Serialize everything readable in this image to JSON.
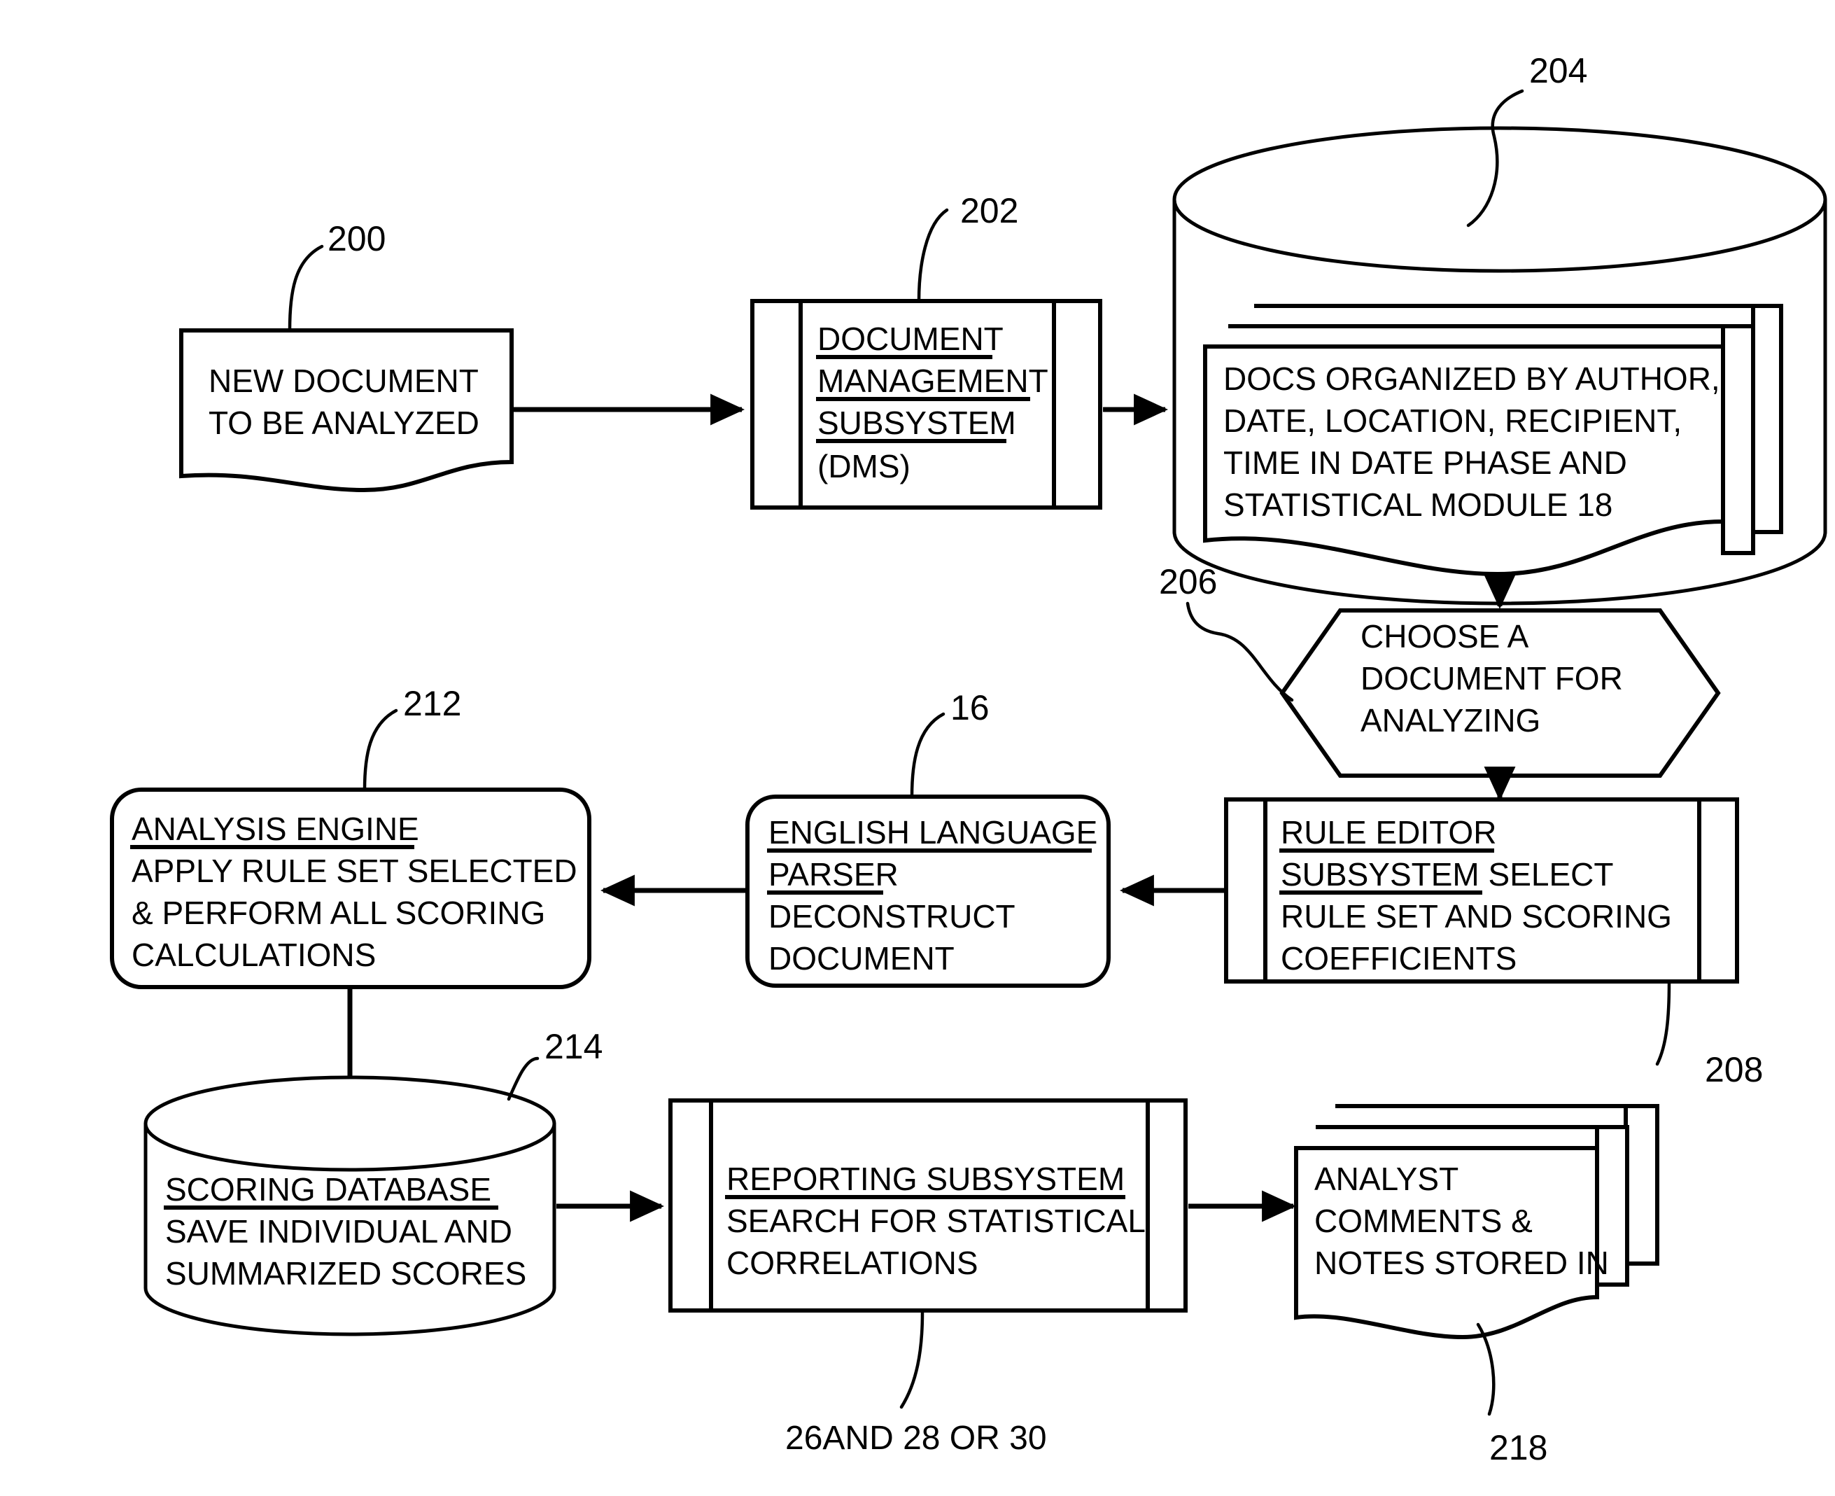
{
  "diagram": {
    "type": "patent-flowchart",
    "title": "Document analysis system flowchart",
    "nodes": [
      {
        "id": "new-document",
        "ref": "200",
        "shape": "document",
        "lines": [
          {
            "text": "NEW DOCUMENT",
            "underline": false
          },
          {
            "text": "TO BE ANALYZED",
            "underline": false
          }
        ]
      },
      {
        "id": "dms",
        "ref": "202",
        "shape": "predefined-process",
        "lines": [
          {
            "text": "DOCUMENT",
            "underline": true
          },
          {
            "text": "MANAGEMENT",
            "underline": true
          },
          {
            "text": "SUBSYSTEM",
            "underline": true
          },
          {
            "text": "(DMS)",
            "underline": false
          }
        ]
      },
      {
        "id": "docs-database",
        "ref": "204",
        "shape": "cylinder-with-stacked-docs",
        "lines": [
          {
            "text": "DOCS ORGANIZED BY AUTHOR,",
            "underline": false
          },
          {
            "text": "DATE, LOCATION, RECIPIENT,",
            "underline": false
          },
          {
            "text": "TIME IN DATE PHASE AND",
            "underline": false
          },
          {
            "text": "STATISTICAL MODULE 18",
            "underline": false
          }
        ]
      },
      {
        "id": "choose-document",
        "ref": "206",
        "shape": "hexagon",
        "lines": [
          {
            "text": "CHOOSE A",
            "underline": false
          },
          {
            "text": "DOCUMENT FOR",
            "underline": false
          },
          {
            "text": "ANALYZING",
            "underline": false
          }
        ]
      },
      {
        "id": "rule-editor",
        "ref": "208",
        "shape": "predefined-process",
        "lines": [
          {
            "text": "RULE EDITOR",
            "underline": true
          },
          {
            "text": "SUBSYSTEM SELECT",
            "underline": "partial"
          },
          {
            "text": "RULE SET AND SCORING",
            "underline": false
          },
          {
            "text": "COEFFICIENTS",
            "underline": false
          }
        ]
      },
      {
        "id": "english-parser",
        "ref": "16",
        "shape": "rounded-rect",
        "lines": [
          {
            "text": "ENGLISH LANGUAGE",
            "underline": true
          },
          {
            "text": "PARSER",
            "underline": true
          },
          {
            "text": "DECONSTRUCT",
            "underline": false
          },
          {
            "text": "DOCUMENT",
            "underline": false
          }
        ]
      },
      {
        "id": "analysis-engine",
        "ref": "212",
        "shape": "rounded-rect",
        "lines": [
          {
            "text": "ANALYSIS ENGINE",
            "underline": true
          },
          {
            "text": "APPLY RULE SET SELECTED",
            "underline": false
          },
          {
            "text": "& PERFORM ALL SCORING",
            "underline": false
          },
          {
            "text": "CALCULATIONS",
            "underline": false
          }
        ]
      },
      {
        "id": "scoring-database",
        "ref": "214",
        "shape": "cylinder",
        "lines": [
          {
            "text": "SCORING DATABASE",
            "underline": true
          },
          {
            "text": "SAVE INDIVIDUAL AND",
            "underline": false
          },
          {
            "text": "SUMMARIZED SCORES",
            "underline": false
          }
        ]
      },
      {
        "id": "reporting-subsystem",
        "ref": "26AND 28 OR 30",
        "shape": "predefined-process",
        "lines": [
          {
            "text": "REPORTING SUBSYSTEM",
            "underline": true
          },
          {
            "text": "SEARCH FOR STATISTICAL",
            "underline": false
          },
          {
            "text": "CORRELATIONS",
            "underline": false
          }
        ]
      },
      {
        "id": "analyst-comments",
        "ref": "218",
        "shape": "stacked-document",
        "lines": [
          {
            "text": "ANALYST",
            "underline": false
          },
          {
            "text": "COMMENTS &",
            "underline": false
          },
          {
            "text": "NOTES STORED IN",
            "underline": false
          }
        ]
      }
    ],
    "edges": [
      {
        "from": "new-document",
        "to": "dms",
        "direction": "right"
      },
      {
        "from": "dms",
        "to": "docs-database",
        "direction": "right"
      },
      {
        "from": "docs-database",
        "to": "choose-document",
        "direction": "down"
      },
      {
        "from": "choose-document",
        "to": "rule-editor",
        "direction": "down"
      },
      {
        "from": "rule-editor",
        "to": "english-parser",
        "direction": "left"
      },
      {
        "from": "english-parser",
        "to": "analysis-engine",
        "direction": "left"
      },
      {
        "from": "analysis-engine",
        "to": "scoring-database",
        "direction": "down"
      },
      {
        "from": "scoring-database",
        "to": "reporting-subsystem",
        "direction": "right"
      },
      {
        "from": "reporting-subsystem",
        "to": "analyst-comments",
        "direction": "right"
      }
    ],
    "ref_labels": {
      "new_document": "200",
      "dms": "202",
      "docs_database": "204",
      "choose_document": "206",
      "rule_editor": "208",
      "english_parser": "16",
      "analysis_engine": "212",
      "scoring_database": "214",
      "reporting_subsystem": "26AND 28 OR 30",
      "analyst_comments": "218"
    },
    "node_text": {
      "new_document": {
        "l1": "NEW DOCUMENT",
        "l2": "TO BE ANALYZED"
      },
      "dms": {
        "l1": "DOCUMENT",
        "l2": "MANAGEMENT",
        "l3": "SUBSYSTEM",
        "l4": "(DMS)"
      },
      "docs_database": {
        "l1": "DOCS ORGANIZED BY AUTHOR,",
        "l2": "DATE, LOCATION, RECIPIENT,",
        "l3": "TIME IN DATE PHASE AND",
        "l4": "STATISTICAL MODULE 18"
      },
      "choose_document": {
        "l1": "CHOOSE A",
        "l2": "DOCUMENT FOR",
        "l3": "ANALYZING"
      },
      "rule_editor": {
        "l1": "RULE EDITOR",
        "l2": "SUBSYSTEM SELECT",
        "l3": "RULE SET AND SCORING",
        "l4": "COEFFICIENTS"
      },
      "english_parser": {
        "l1": "ENGLISH LANGUAGE",
        "l2": "PARSER",
        "l3": "DECONSTRUCT",
        "l4": "DOCUMENT"
      },
      "analysis_engine": {
        "l1": "ANALYSIS ENGINE",
        "l2": "APPLY RULE SET SELECTED",
        "l3": "& PERFORM ALL SCORING",
        "l4": "CALCULATIONS"
      },
      "scoring_database": {
        "l1": "SCORING DATABASE",
        "l2": "SAVE INDIVIDUAL AND",
        "l3": "SUMMARIZED SCORES"
      },
      "reporting_subsystem": {
        "l1": "REPORTING SUBSYSTEM",
        "l2": "SEARCH FOR STATISTICAL",
        "l3": "CORRELATIONS"
      },
      "analyst_comments": {
        "l1": "ANALYST",
        "l2": "COMMENTS &",
        "l3": "NOTES STORED IN"
      }
    },
    "colors": {
      "ink": "#000000",
      "paper": "#ffffff"
    }
  }
}
